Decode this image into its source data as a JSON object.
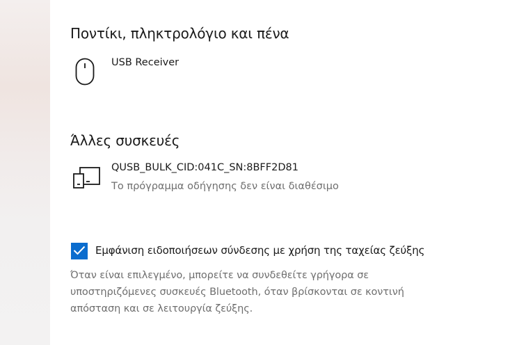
{
  "mouse_section": {
    "title": "Ποντίκι, πληκτρολόγιο και πένα",
    "device": {
      "name": "USB Receiver",
      "icon": "mouse-icon"
    }
  },
  "other_section": {
    "title": "Άλλες συσκευές",
    "device": {
      "name": "QUSB_BULK_CID:041C_SN:8BFF2D81",
      "status": "Το πρόγραμμα οδήγησης δεν είναι διαθέσιμο",
      "icon": "devices-icon"
    }
  },
  "swift_pair": {
    "checked": true,
    "label": "Εμφάνιση ειδοποιήσεων σύνδεσης με χρήση της ταχείας ζεύξης",
    "description": "Όταν είναι επιλεγμένο, μπορείτε να συνδεθείτε γρήγορα σε υποστηριζόμενες συσκευές Bluetooth, όταν βρίσκονται σε κοντινή απόσταση και σε λειτουργία ζεύξης.",
    "accent_color": "#0a6cce"
  }
}
